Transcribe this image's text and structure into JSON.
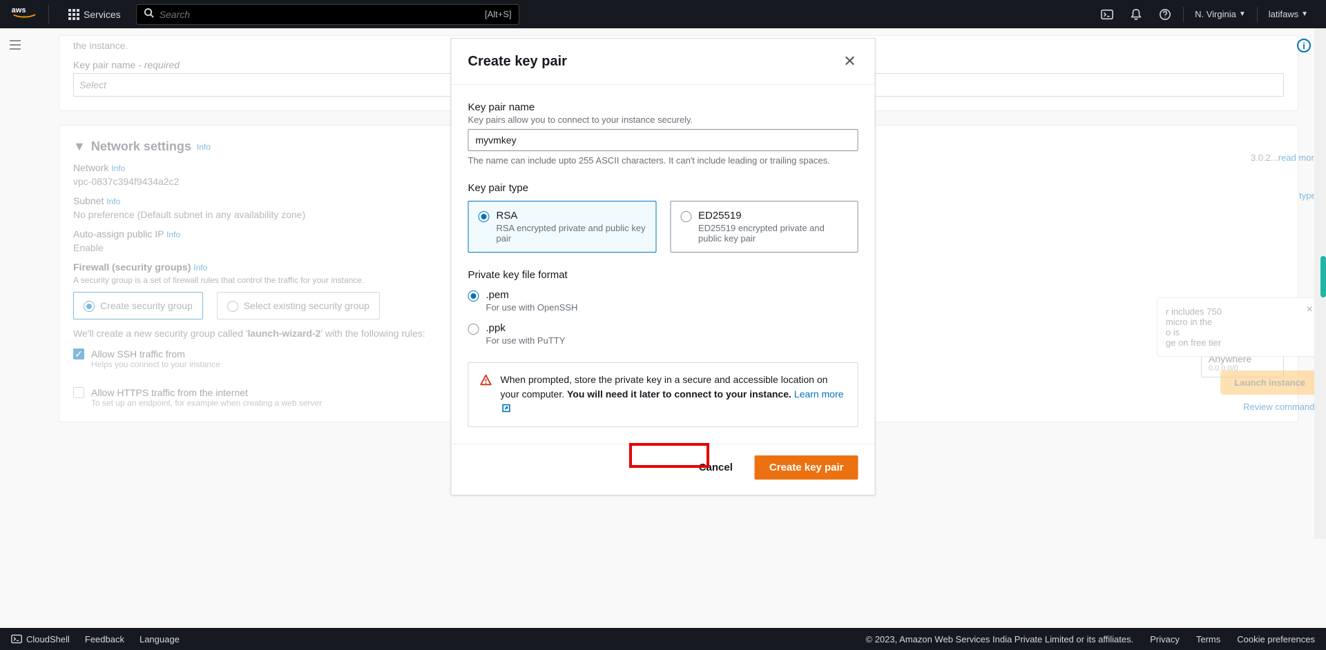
{
  "topnav": {
    "logo": "aws",
    "services": "Services",
    "search_placeholder": "Search",
    "search_hint": "[Alt+S]",
    "region": "N. Virginia",
    "user": "latifaws"
  },
  "background": {
    "instance_hint": "the instance.",
    "keypair_label": "Key pair name -",
    "keypair_req": "required",
    "keypair_placeholder": "Select",
    "netset_title": "Network settings",
    "info": "Info",
    "network_label": "Network",
    "network_value": "vpc-0837c394f9434a2c2",
    "subnet_label": "Subnet",
    "subnet_value": "No preference (Default subnet in any availability zone)",
    "autoip_label": "Auto-assign public IP",
    "autoip_value": "Enable",
    "firewall_label": "Firewall (security groups)",
    "firewall_desc": "A security group is a set of firewall rules that control the traffic for your instance.",
    "create_sg": "Create security group",
    "select_sg": "Select existing security group",
    "sg_text_a": "We'll create a new security group called '",
    "sg_text_b": "launch-wizard-2",
    "sg_text_c": "' with the following rules:",
    "allow_ssh": "Allow SSH traffic from",
    "allow_ssh_desc": "Helps you connect to your instance",
    "anywhere": "Anywhere",
    "anywhere_ip": "0.0.0.0/0",
    "allow_https": "Allow HTTPS traffic from the internet",
    "allow_https_desc": "To set up an endpoint, for example when creating a web server",
    "readmore_prefix": "3.0.2...",
    "readmore": "read more",
    "type_hint": "type)",
    "free_tier_1": "r includes 750",
    "free_tier_2": "micro in the",
    "free_tier_3": "o is",
    "free_tier_4": "ge on free tier",
    "launch_btn": "Launch instance",
    "review": "Review commands"
  },
  "modal": {
    "title": "Create key pair",
    "name_label": "Key pair name",
    "name_desc": "Key pairs allow you to connect to your instance securely.",
    "name_value": "myvmkey",
    "name_hint": "The name can include upto 255 ASCII characters. It can't include leading or trailing spaces.",
    "type_label": "Key pair type",
    "rsa_title": "RSA",
    "rsa_desc": "RSA encrypted private and public key pair",
    "ed_title": "ED25519",
    "ed_desc": "ED25519 encrypted private and public key pair",
    "format_label": "Private key file format",
    "pem_title": ".pem",
    "pem_desc": "For use with OpenSSH",
    "ppk_title": ".ppk",
    "ppk_desc": "For use with PuTTY",
    "warn_a": "When prompted, store the private key in a secure and accessible location on your computer. ",
    "warn_b": "You will need it later to connect to your instance.",
    "warn_link": "Learn more",
    "cancel": "Cancel",
    "create": "Create key pair"
  },
  "footer": {
    "cloudshell": "CloudShell",
    "feedback": "Feedback",
    "language": "Language",
    "copyright": "© 2023, Amazon Web Services India Private Limited or its affiliates.",
    "privacy": "Privacy",
    "terms": "Terms",
    "cookies": "Cookie preferences"
  }
}
